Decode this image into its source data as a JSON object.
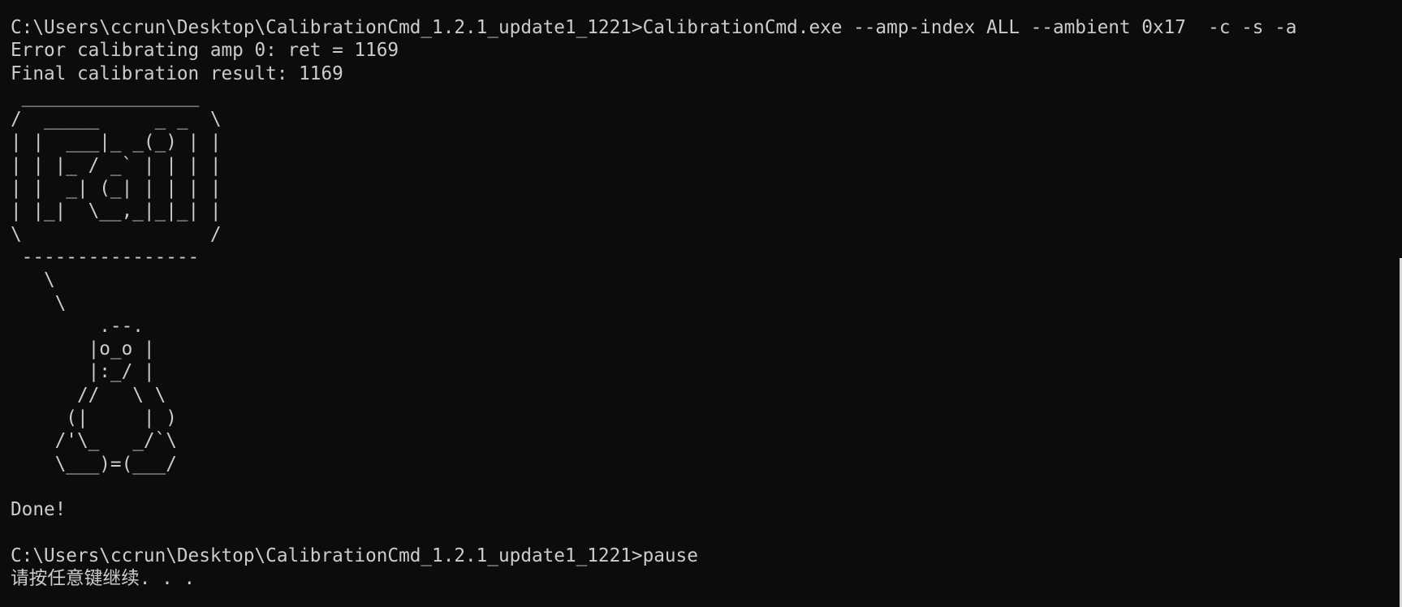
{
  "terminal": {
    "lines": [
      "C:\\Users\\ccrun\\Desktop\\CalibrationCmd_1.2.1_update1_1221>CalibrationCmd.exe --amp-index ALL --ambient 0x17  -c -s -a",
      "Error calibrating amp 0: ret = 1169",
      "Final calibration result: 1169",
      " ________________",
      "/  _____     _ _  \\",
      "| |  ___|_ _(_) | |",
      "| | |_ / _` | | | |",
      "| |  _| (_| | | | |",
      "| |_|  \\__,_|_|_| |",
      "\\                 /",
      " ----------------",
      "   \\",
      "    \\",
      "        .--.",
      "       |o_o |",
      "       |:_/ |",
      "      //   \\ \\",
      "     (|     | )",
      "    /'\\_   _/`\\",
      "    \\___)=(___/",
      "",
      "Done!",
      "",
      "C:\\Users\\ccrun\\Desktop\\CalibrationCmd_1.2.1_update1_1221>pause",
      "请按任意键继续. . ."
    ]
  }
}
